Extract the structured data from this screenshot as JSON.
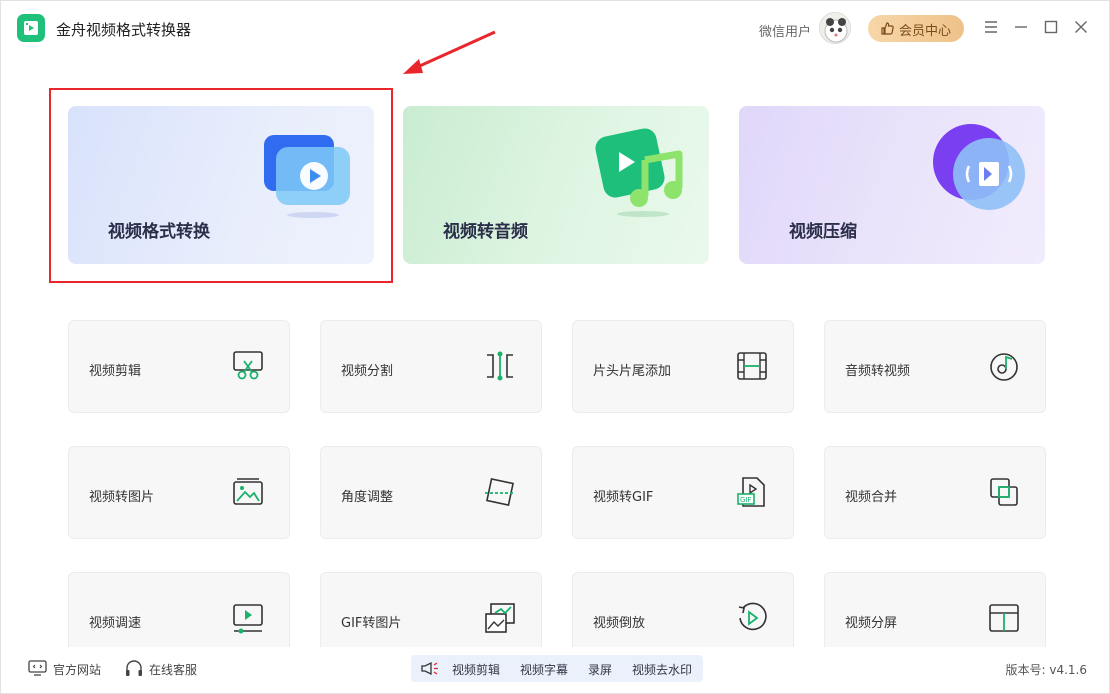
{
  "app": {
    "title": "金舟视频格式转换器"
  },
  "header": {
    "user_label": "微信用户",
    "vip_label": "会员中心",
    "colors": {
      "vip_bg": "#f3cf9b",
      "logo": "#1fc07a"
    }
  },
  "feature_cards": [
    {
      "label": "视频格式转换",
      "icon": "video-convert-icon"
    },
    {
      "label": "视频转音频",
      "icon": "video-to-audio-icon"
    },
    {
      "label": "视频压缩",
      "icon": "video-compress-icon"
    }
  ],
  "tools": [
    {
      "label": "视频剪辑",
      "icon": "scissors-icon"
    },
    {
      "label": "视频分割",
      "icon": "split-icon"
    },
    {
      "label": "片头片尾添加",
      "icon": "film-icon"
    },
    {
      "label": "音频转视频",
      "icon": "music-disc-icon"
    },
    {
      "label": "视频转图片",
      "icon": "image-icon"
    },
    {
      "label": "角度调整",
      "icon": "rotate-icon"
    },
    {
      "label": "视频转GIF",
      "icon": "gif-file-icon"
    },
    {
      "label": "视频合并",
      "icon": "merge-icon"
    },
    {
      "label": "视频调速",
      "icon": "speed-icon"
    },
    {
      "label": "GIF转图片",
      "icon": "gif-to-image-icon"
    },
    {
      "label": "视频倒放",
      "icon": "reverse-icon"
    },
    {
      "label": "视频分屏",
      "icon": "split-screen-icon"
    }
  ],
  "footer": {
    "website_label": "官方网站",
    "service_label": "在线客服",
    "promo_items": [
      "视频剪辑",
      "视频字幕",
      "录屏",
      "视频去水印"
    ],
    "version": "版本号: v4.1.6"
  },
  "annotation": {
    "highlight_color": "#e8262c"
  }
}
